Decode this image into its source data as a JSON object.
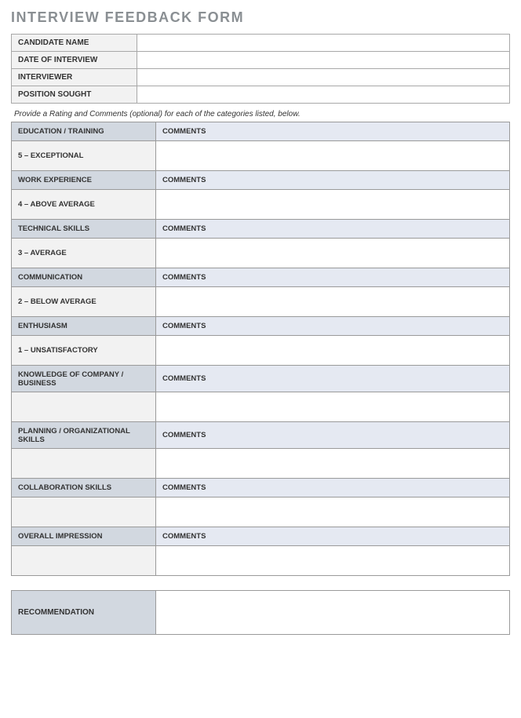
{
  "title": "INTERVIEW FEEDBACK FORM",
  "info": [
    {
      "label": "CANDIDATE NAME",
      "value": ""
    },
    {
      "label": "DATE OF INTERVIEW",
      "value": ""
    },
    {
      "label": "INTERVIEWER",
      "value": ""
    },
    {
      "label": "POSITION SOUGHT",
      "value": ""
    }
  ],
  "instructions": "Provide a Rating and Comments (optional) for each of the categories listed, below.",
  "comments_label": "COMMENTS",
  "categories": [
    {
      "name": "EDUCATION / TRAINING",
      "rating_label": "5 – EXCEPTIONAL",
      "tall": false
    },
    {
      "name": "WORK EXPERIENCE",
      "rating_label": "4 – ABOVE AVERAGE",
      "tall": false
    },
    {
      "name": "TECHNICAL SKILLS",
      "rating_label": "3 – AVERAGE",
      "tall": false
    },
    {
      "name": "COMMUNICATION",
      "rating_label": "2 – BELOW AVERAGE",
      "tall": false
    },
    {
      "name": "ENTHUSIASM",
      "rating_label": "1 – UNSATISFACTORY",
      "tall": false
    },
    {
      "name": "KNOWLEDGE OF COMPANY / BUSINESS",
      "rating_label": "",
      "tall": true
    },
    {
      "name": "PLANNING / ORGANIZATIONAL SKILLS",
      "rating_label": "",
      "tall": true
    },
    {
      "name": "COLLABORATION SKILLS",
      "rating_label": "",
      "tall": false
    },
    {
      "name": "OVERALL IMPRESSION",
      "rating_label": "",
      "tall": false
    }
  ],
  "recommendation_label": "RECOMMENDATION",
  "recommendation_value": ""
}
